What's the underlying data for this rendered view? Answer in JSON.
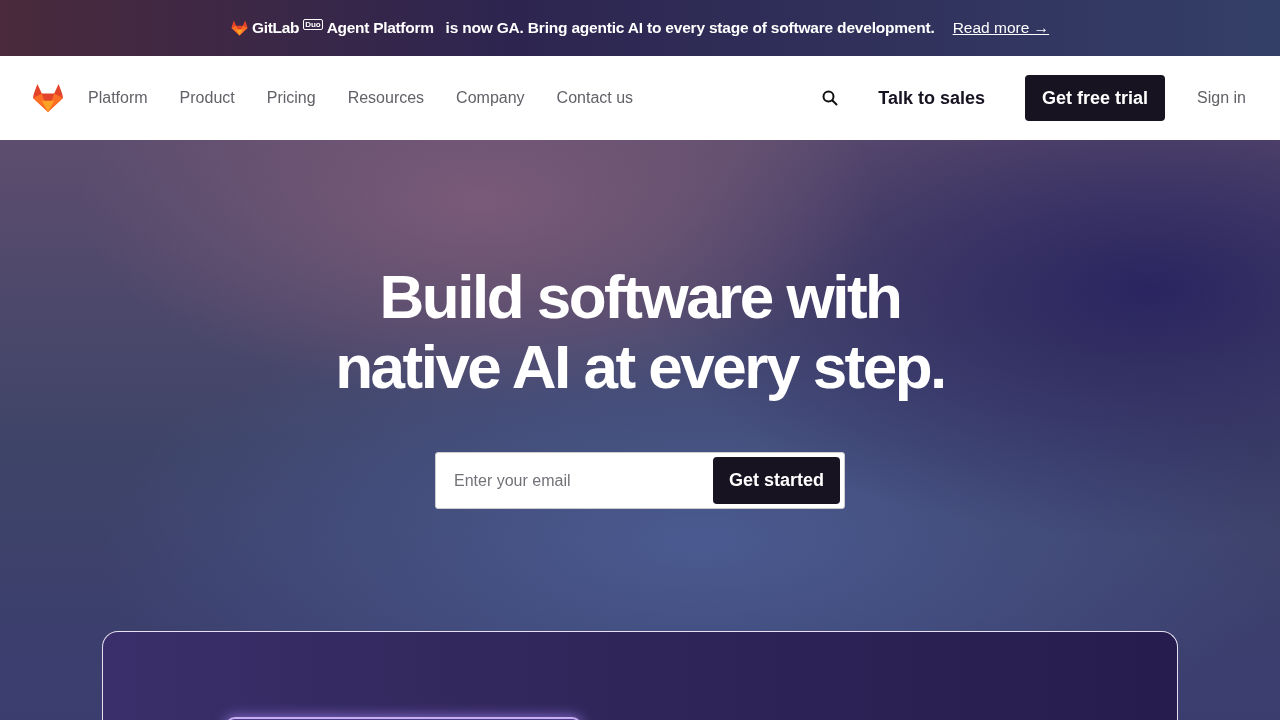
{
  "banner": {
    "brand": "GitLab",
    "badge": "Duo",
    "product": "Agent Platform",
    "message": "is now GA. Bring agentic AI to every stage of software development.",
    "link": "Read more →"
  },
  "nav": {
    "items": [
      "Platform",
      "Product",
      "Pricing",
      "Resources",
      "Company",
      "Contact us"
    ],
    "sales": "Talk to sales",
    "trial": "Get free trial",
    "signin": "Sign in"
  },
  "hero": {
    "lines": [
      "Build software with",
      "native AI at every step."
    ],
    "email": {
      "placeholder": "Enter your email"
    },
    "cta": "Get started"
  }
}
